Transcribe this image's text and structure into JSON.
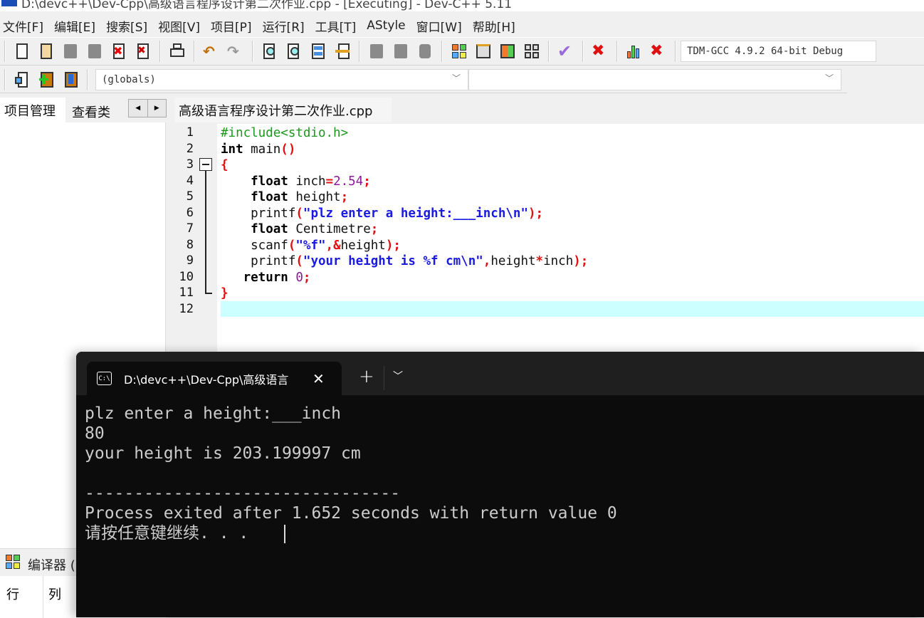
{
  "window": {
    "title": "D:\\devc++\\Dev-Cpp\\高级语言程序设计第二次作业.cpp - [Executing] - Dev-C++ 5.11"
  },
  "menu": [
    "文件[F]",
    "编辑[E]",
    "搜索[S]",
    "视图[V]",
    "项目[P]",
    "运行[R]",
    "工具[T]",
    "AStyle",
    "窗口[W]",
    "帮助[H]"
  ],
  "toolbar": {
    "compiler": "TDM-GCC 4.9.2 64-bit Debug",
    "globals": "(globals)",
    "second_combo": ""
  },
  "left_tabs": {
    "project": "项目管理",
    "classes": "查看类"
  },
  "editor": {
    "tab": "高级语言程序设计第二次作业.cpp",
    "lines": [
      [
        [
          "pre",
          "#include<stdio.h>"
        ]
      ],
      [
        [
          "kw",
          "int"
        ],
        [
          "id",
          " main"
        ],
        [
          "op",
          "()"
        ]
      ],
      [
        [
          "op",
          "{"
        ]
      ],
      [
        [
          "id",
          "    "
        ],
        [
          "kw",
          "float"
        ],
        [
          "id",
          " inch"
        ],
        [
          "op",
          "="
        ],
        [
          "num",
          "2.54"
        ],
        [
          "op",
          ";"
        ]
      ],
      [
        [
          "id",
          "    "
        ],
        [
          "kw",
          "float"
        ],
        [
          "id",
          " height"
        ],
        [
          "op",
          ";"
        ]
      ],
      [
        [
          "id",
          "    printf"
        ],
        [
          "op",
          "("
        ],
        [
          "str",
          "\"plz enter a height:___inch\\n\""
        ],
        [
          "op",
          ");"
        ]
      ],
      [
        [
          "id",
          "    "
        ],
        [
          "kw",
          "float"
        ],
        [
          "id",
          " Centimetre"
        ],
        [
          "op",
          ";"
        ]
      ],
      [
        [
          "id",
          "    scanf"
        ],
        [
          "op",
          "("
        ],
        [
          "str",
          "\"%f\""
        ],
        [
          "op",
          ",&"
        ],
        [
          "id",
          "height"
        ],
        [
          "op",
          ");"
        ]
      ],
      [
        [
          "id",
          "    printf"
        ],
        [
          "op",
          "("
        ],
        [
          "str",
          "\"your height is %f cm\\n\""
        ],
        [
          "op",
          ","
        ],
        [
          "id",
          "height"
        ],
        [
          "op",
          "*"
        ],
        [
          "id",
          "inch"
        ],
        [
          "op",
          ");"
        ]
      ],
      [
        [
          "id",
          "   "
        ],
        [
          "kw",
          "return"
        ],
        [
          "id",
          " "
        ],
        [
          "num",
          "0"
        ],
        [
          "op",
          ";"
        ]
      ],
      [
        [
          "op",
          "}"
        ]
      ],
      []
    ]
  },
  "bottom_panel": {
    "compiler_tab": "编译器 (",
    "row_label": "行",
    "col_label": "列"
  },
  "terminal": {
    "tab_title": "D:\\devc++\\Dev-Cpp\\高级语言",
    "output": [
      "plz enter a height:___inch",
      "80",
      "your height is 203.199997 cm",
      "",
      "--------------------------------",
      "Process exited after 1.652 seconds with return value 0",
      "请按任意键继续. . . "
    ]
  }
}
